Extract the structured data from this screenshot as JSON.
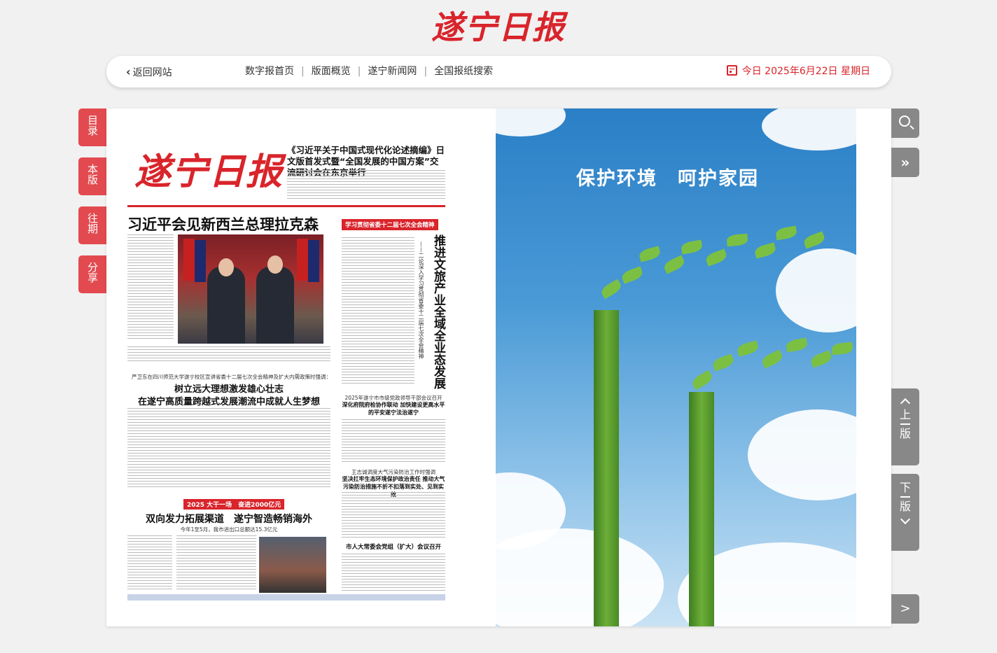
{
  "masthead": {
    "logo": "遂宁日报"
  },
  "nav": {
    "back_label": "返回网站",
    "links": [
      "数字报首页",
      "版面概览",
      "遂宁新闻网",
      "全国报纸搜索"
    ],
    "separator": "|",
    "date_text": "今日 2025年6月22日 星期日"
  },
  "left_tools": [
    "目录",
    "本版",
    "往期",
    "分享"
  ],
  "right_tools": {
    "prev_page": [
      "上",
      "版"
    ],
    "next_page": [
      "下",
      "版"
    ],
    "next_arrow": ">"
  },
  "front_page": {
    "masthead": "遂宁日报",
    "top_headline": "《习近平关于中国式现代化论述摘编》日文版首发式暨“全国发展的中国方案”交流研讨会在东京举行",
    "main_headline": "习近平会见新西兰总理拉克森",
    "column_tag": "学习贯彻省委十二届七次全会精神",
    "vertical_headline": "推进文旅产业全域全业态发展",
    "vertical_subhead": "——二论深入学习贯彻省委十二届七次全会精神",
    "story2_kicker": "严卫东在四川师范大学遂宁校区宣讲省委十二届七次全会精神及扩大内需政策时强调：",
    "story2_line1": "树立远大理想激发雄心壮志",
    "story2_line2": "在遂宁高质量跨越式发展潮流中成就人生梦想",
    "side_story1_kicker": "2025年遂宁市市级党政领导干部会议召开",
    "side_story1_head": "深化府院府检协作联动 加快建设更高水平的平安遂宁法治遂宁",
    "side_story2_kicker": "王志诚调度大气污染防治工作时强调",
    "side_story2_head": "坚决扛牢生态环境保护政治责任 推动大气污染防治措施不折不扣落到实处、见到实效",
    "side_story3_head": "市人大常委会党组（扩大）会议召开",
    "banner": "2025 大干一场　奋进2000亿元",
    "story3_head": "双向发力拓展渠道　遂宁智造畅销海外",
    "story3_sub": "今年1至5月，我市进出口总额达15.3亿元"
  },
  "poster": {
    "slogan": "保护环境　呵护家园"
  },
  "colors": {
    "brand_red": "#d9242b",
    "side_red": "#e24a4f",
    "control_gray": "#888888"
  }
}
